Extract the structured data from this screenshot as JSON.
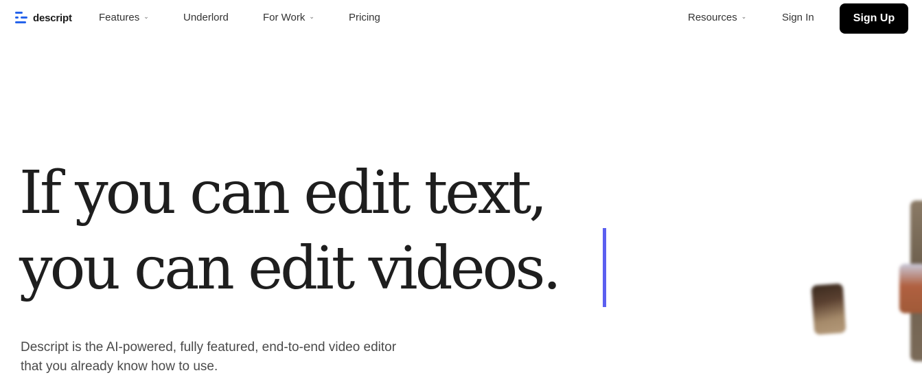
{
  "brand": {
    "name": "descript",
    "color": "#2563eb"
  },
  "nav": {
    "left_items": [
      {
        "label": "Features",
        "dropdown": true
      },
      {
        "label": "Underlord",
        "dropdown": false
      },
      {
        "label": "For Work",
        "dropdown": true
      },
      {
        "label": "Pricing",
        "dropdown": false
      }
    ],
    "right_items": [
      {
        "label": "Resources",
        "dropdown": true
      },
      {
        "label": "Sign In",
        "dropdown": false
      }
    ],
    "cta_label": "Sign Up",
    "chevron_glyph": "⌄"
  },
  "hero": {
    "line1": "If you can edit text,",
    "line2": "you can edit videos.",
    "caret_color": "#5b5ff0",
    "subtitle_line1": "Descript is the AI-powered, fully featured, end-to-end video editor",
    "subtitle_line2": "that you already know how to use."
  }
}
